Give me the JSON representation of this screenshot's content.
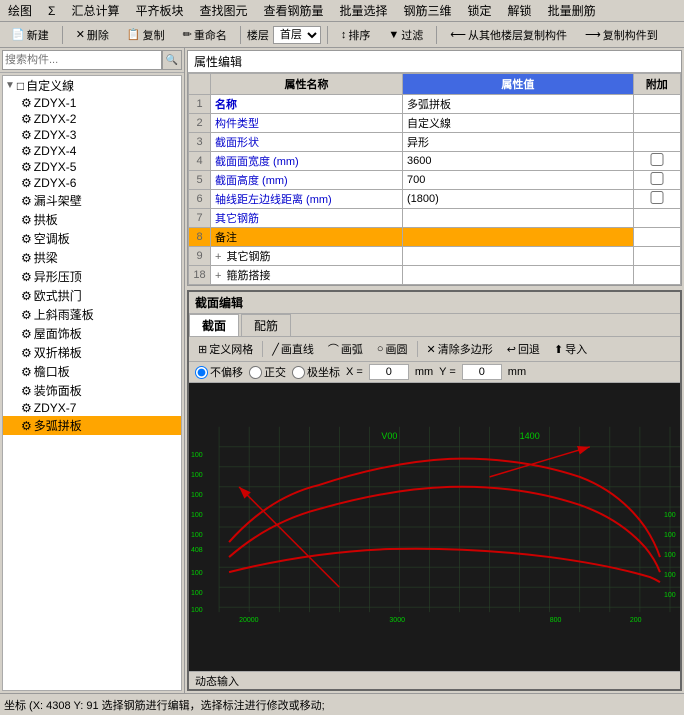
{
  "menubar": {
    "items": [
      "绘图",
      "Σ",
      "汇总计算",
      "平齐板块",
      "查找图元",
      "查看钢筋量",
      "批量选择",
      "钢筋三维",
      "锁定",
      "解锁",
      "批量删筋"
    ]
  },
  "toolbar": {
    "new": "新建",
    "delete": "删除",
    "copy": "复制",
    "rename": "重命名",
    "layer": "楼层",
    "layer_val": "首层",
    "sort": "排序",
    "filter": "过滤",
    "copy_from": "从其他楼层复制构件",
    "copy_to": "复制构件到"
  },
  "left_panel": {
    "search_placeholder": "搜索构件...",
    "tree": {
      "root": "自定义線",
      "items": [
        "ZDYX-1",
        "ZDYX-2",
        "ZDYX-3",
        "ZDYX-4",
        "ZDYX-5",
        "ZDYX-6",
        "漏斗架壁",
        "拱板",
        "空调板",
        "拱梁",
        "异形压顶",
        "欧式拱门",
        "上斜雨蓬板",
        "屋面饰板",
        "双折梯板",
        "檐口板",
        "装饰面板",
        "ZDYX-7",
        "多弧拼板"
      ],
      "selected": "多弧拼板"
    }
  },
  "prop_editor": {
    "title": "属性编辑",
    "col_name": "属性名称",
    "col_value": "属性值",
    "col_extra": "附加",
    "rows": [
      {
        "num": "1",
        "name": "名称",
        "value": "多弧拼板",
        "extra": false,
        "name_bold": true
      },
      {
        "num": "2",
        "name": "构件类型",
        "value": "自定义線",
        "extra": false
      },
      {
        "num": "3",
        "name": "截面形状",
        "value": "异形",
        "extra": false
      },
      {
        "num": "4",
        "name": "截面面宽度 (mm)",
        "value": "3600",
        "extra": true
      },
      {
        "num": "5",
        "name": "截面高度 (mm)",
        "value": "700",
        "extra": true
      },
      {
        "num": "6",
        "name": "轴线距左边线距离 (mm)",
        "value": "(1800)",
        "extra": true
      },
      {
        "num": "7",
        "name": "其它钢筋",
        "value": "",
        "extra": false
      },
      {
        "num": "8",
        "name": "备注",
        "value": "",
        "extra": false,
        "highlight": true
      },
      {
        "num": "9",
        "name": "+ 其它钢筋",
        "value": "",
        "extra": false,
        "expand": true
      },
      {
        "num": "18",
        "name": "+ 箍筋搭接",
        "value": "",
        "extra": false,
        "expand": true
      }
    ]
  },
  "section_editor": {
    "title": "截面编辑",
    "tabs": [
      "截面",
      "配筋"
    ],
    "active_tab": 0,
    "toolbar": [
      {
        "label": "定义网格",
        "icon": "grid"
      },
      {
        "label": "画直线",
        "icon": "line"
      },
      {
        "label": "画弧",
        "icon": "arc"
      },
      {
        "label": "画圆",
        "icon": "circle"
      },
      {
        "label": "清除多边形",
        "icon": "clear"
      },
      {
        "label": "回退",
        "icon": "undo"
      },
      {
        "label": "导入",
        "icon": "import"
      }
    ],
    "coord_mode": "不偏移",
    "coord_modes": [
      "不偏移",
      "正交",
      "极坐标"
    ],
    "x_label": "X =",
    "x_val": "0",
    "x_unit": "mm",
    "y_label": "Y =",
    "y_val": "0",
    "y_unit": "mm"
  },
  "canvas": {
    "grid_labels_x": [
      "20000",
      "3000",
      "800",
      "200"
    ],
    "grid_labels_y": [
      "100",
      "100",
      "100",
      "100",
      "100",
      "100",
      "100",
      "100",
      "100"
    ],
    "top_labels": [
      "V00",
      "1400"
    ],
    "left_labels": [
      "408",
      "100"
    ],
    "right_labels": [
      "100",
      "100",
      "100",
      "100",
      "100"
    ]
  },
  "dynamic_input": "动态输入",
  "statusbar": "坐标 (X: 4308 Y: 91 选择钢筋进行编辑，选择标注进行修改或移动;"
}
